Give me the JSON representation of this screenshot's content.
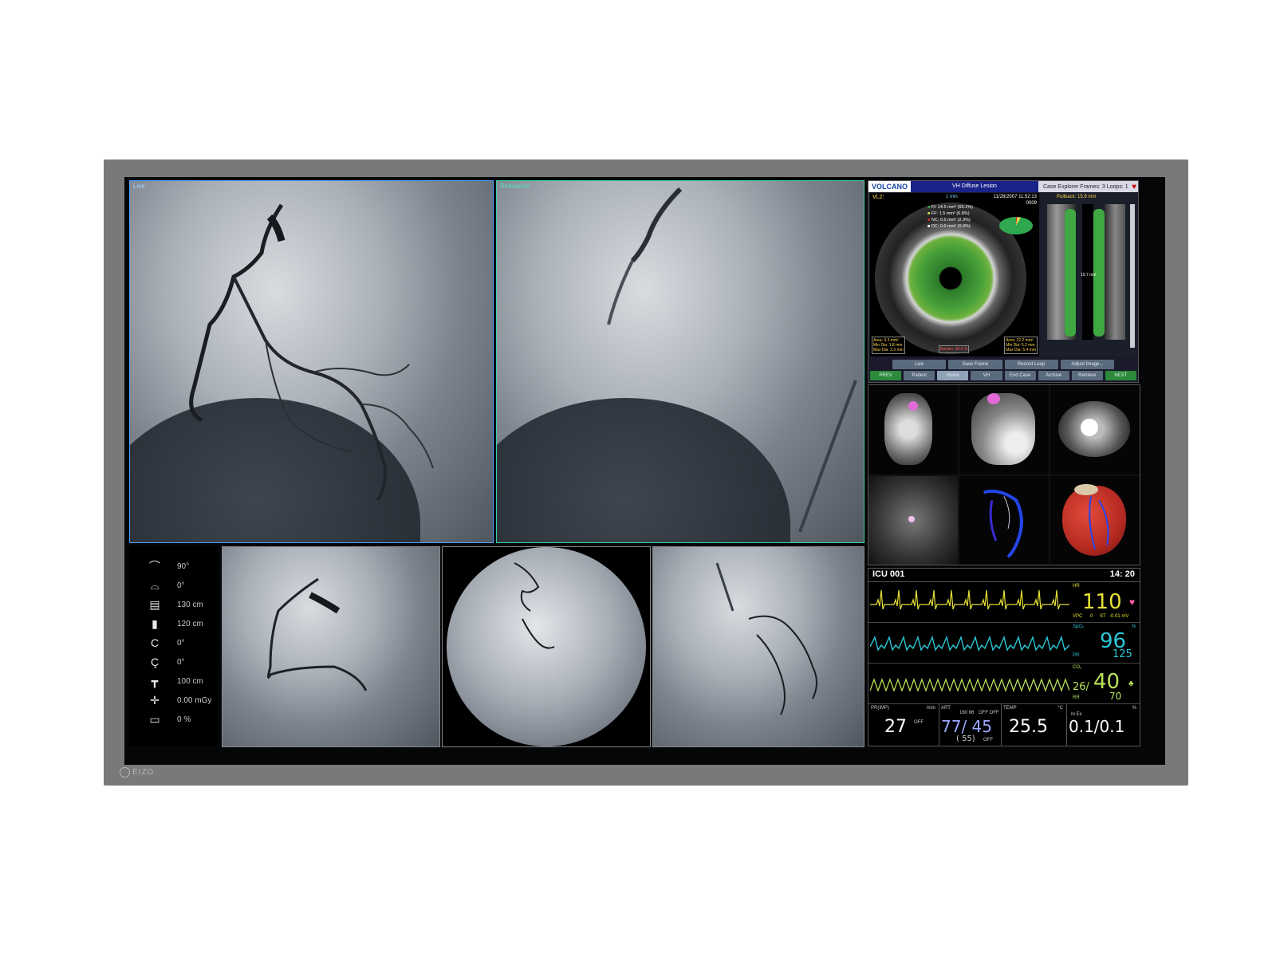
{
  "monitor_brand": "EIZO",
  "geometry_panel": {
    "rows": [
      {
        "icon": "tilt-icon",
        "glyph": "⌒",
        "value": "90°"
      },
      {
        "icon": "rotation-icon",
        "glyph": "⌓",
        "value": "0°"
      },
      {
        "icon": "sid-icon",
        "glyph": "▤",
        "value": "130 cm"
      },
      {
        "icon": "table-height-icon",
        "glyph": "▮",
        "value": "120 cm"
      },
      {
        "icon": "c-arm-rotate-icon",
        "glyph": "C",
        "value": "0°"
      },
      {
        "icon": "c-arm-angulate-icon",
        "glyph": "Ç",
        "value": "0°"
      },
      {
        "icon": "table-icon",
        "glyph": "┳",
        "value": "100 cm"
      },
      {
        "icon": "dose-icon",
        "glyph": "✛",
        "value": "0.00 mGy"
      },
      {
        "icon": "battery-icon",
        "glyph": "▭",
        "value": "0 %"
      }
    ]
  },
  "ivus": {
    "brand": "VOLCANO",
    "title": "VH Diffuse Lesion",
    "case_info": "Case Explorer   Frames: 3   Loops: 1",
    "vessel_label": "VL2:",
    "frame_label": "1 min",
    "datetime": "11/28/2007 11:52:13",
    "frame_no": "0009",
    "legend": [
      {
        "label": "FI: 14.5 mm² (65.1%)",
        "color": "#2fa84f"
      },
      {
        "label": "FF: 1.5 mm² (6.8%)",
        "color": "#d7e04a"
      },
      {
        "label": "NC: 0.5 mm² (2.3%)",
        "color": "#e02a2a"
      },
      {
        "label": "DC: 0.0 mm² (0.0%)",
        "color": "#ffffff"
      }
    ],
    "lumen_info": [
      "Area: 3.3 mm²",
      "Min Dia: 1.8 mm",
      "Max Dia: 2.3 mm"
    ],
    "vessel_info": [
      "Area: 22.2 mm²",
      "Min Dia: 5.2 mm",
      "Max Dia: 5.4 mm"
    ],
    "plaque_burden": "Burden: 85.0 %",
    "pullback": "Pullback: 15.9 mm",
    "length_label": "15.7 mm",
    "buttons_row1": [
      "Live",
      "Save Frame",
      "Record Loop",
      "Adjust Image..."
    ],
    "buttons_row2": [
      "PREV",
      "Patient",
      "Home",
      "VH",
      "End Case",
      "Archive",
      "Retrieve",
      "NEXT"
    ]
  },
  "vitals": {
    "bed": "ICU 001",
    "time": "14: 20",
    "hr_label": "HR",
    "hr": "110",
    "vpc_label": "VPC",
    "vpc_value": "0",
    "st_label": "ST",
    "st_value": "-0.01 mV",
    "spo2_label": "SpO₂",
    "spo2_unit": "%",
    "spo2": "96",
    "pr_label": "PR",
    "pr": "125",
    "co2_label": "CO₂",
    "co2_low": "26/",
    "co2": "40",
    "rr_label": "RR",
    "rr": "70",
    "resp_label": "PR(IMP)",
    "resp_unit": "/min",
    "resp": "27",
    "resp_flag": "OFF",
    "art_label": "ART",
    "art_top": "160 96",
    "art_flags": "OFF OFF",
    "art": "77/ 45",
    "art_mean": "( 55)",
    "art_mean_flag": "OFF",
    "temp_label": "TEMP",
    "temp_unit": "°C",
    "temp": "25.5",
    "last_unit": "%",
    "last_sub": "In          Ex",
    "last": "0.1/0.1",
    "colors": {
      "ecg": "#e6e233",
      "spo2": "#29c7d6",
      "co2": "#b7e25a",
      "white": "#ffffff"
    }
  }
}
